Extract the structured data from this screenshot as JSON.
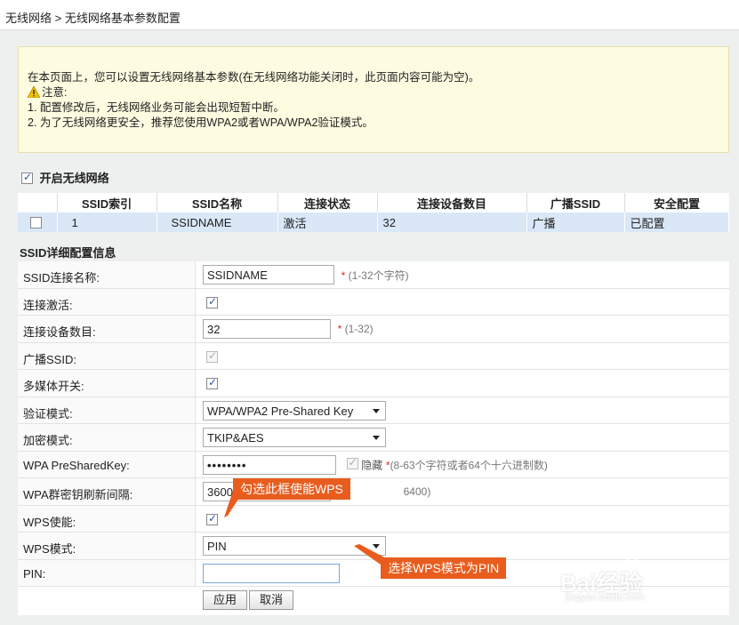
{
  "breadcrumb": "无线网络 > 无线网络基本参数配置",
  "notice": {
    "intro": "在本页面上，您可以设置无线网络基本参数(在无线网络功能关闭时，此页面内容可能为空)。",
    "caution_label": "注意:",
    "line1": "1. 配置修改后，无线网络业务可能会出现短暂中断。",
    "line2": "2. 为了无线网络更安全，推荐您使用WPA2或者WPA/WPA2验证模式。"
  },
  "enable_wireless": {
    "label": "开启无线网络",
    "checked": true
  },
  "ssid_table": {
    "headers": [
      "SSID索引",
      "SSID名称",
      "连接状态",
      "连接设备数目",
      "广播SSID",
      "安全配置"
    ],
    "rows": [
      {
        "index": "1",
        "name": "SSIDNAME",
        "status": "激活",
        "devices": "32",
        "broadcast": "广播",
        "security": "已配置"
      }
    ]
  },
  "detail": {
    "title": "SSID详细配置信息",
    "ssid_name": {
      "label": "SSID连接名称:",
      "value": "SSIDNAME",
      "hint": "(1-32个字符)"
    },
    "active": {
      "label": "连接激活:",
      "checked": true
    },
    "max_devices": {
      "label": "连接设备数目:",
      "value": "32",
      "hint": "(1-32)"
    },
    "broadcast": {
      "label": "广播SSID:",
      "checked": true
    },
    "multimedia": {
      "label": "多媒体开关:",
      "checked": true
    },
    "auth_mode": {
      "label": "验证模式:",
      "value": "WPA/WPA2 Pre-Shared Key"
    },
    "encrypt_mode": {
      "label": "加密模式:",
      "value": "TKIP&AES"
    },
    "psk": {
      "label": "WPA PreSharedKey:",
      "value": "••••••••",
      "hide_label": "隐藏",
      "hint": "(8-63个字符或者64个十六进制数)"
    },
    "rekey": {
      "label": "WPA群密钥刷新间隔:",
      "value": "3600",
      "hint": "6400)"
    },
    "wps_enable": {
      "label": "WPS使能:",
      "checked": true
    },
    "wps_mode": {
      "label": "WPS模式:",
      "value": "PIN"
    },
    "pin": {
      "label": "PIN:",
      "value": ""
    },
    "apply": "应用",
    "cancel": "取消"
  },
  "annotations": {
    "wps_enable_tip": "勾选此框使能WPS",
    "wps_mode_tip": "选择WPS模式为PIN"
  },
  "watermark": {
    "brand": "Bai经验",
    "url": "jingyan.baidu.com"
  },
  "colors": {
    "callout": "#e85d1e",
    "table_row": "#d9e7f7",
    "notice_bg": "#fdfbe0",
    "required": "#d22222"
  }
}
